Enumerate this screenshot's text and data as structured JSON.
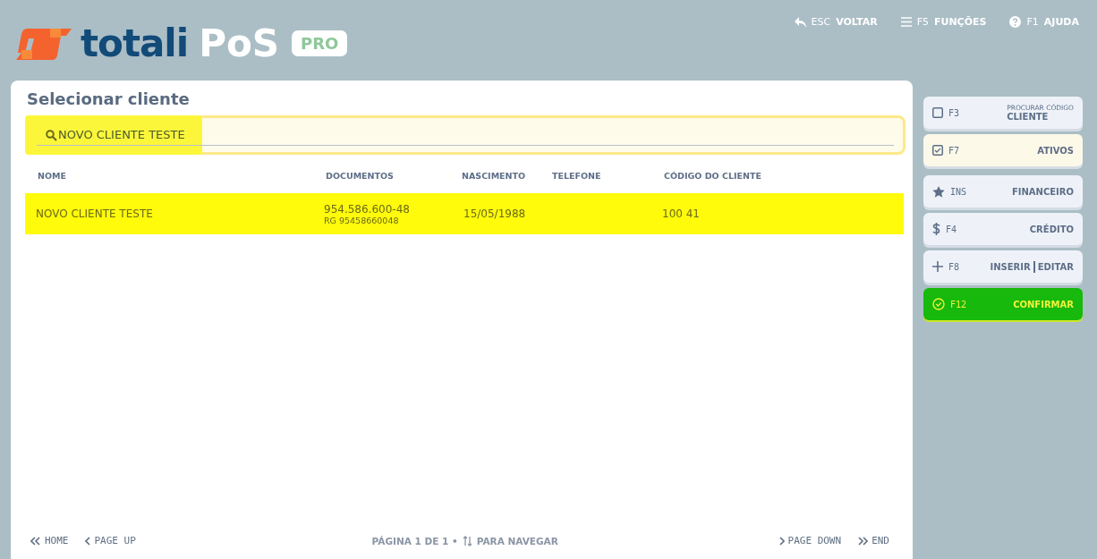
{
  "header": {
    "logo_text": "totali",
    "logo_product": "PoS",
    "logo_badge": "PRO",
    "actions": [
      {
        "kind": "back",
        "key": "ESC",
        "label": "VOLTAR"
      },
      {
        "kind": "menu",
        "key": "F5",
        "label": "FUNÇÕES"
      },
      {
        "kind": "help",
        "key": "F1",
        "label": "AJUDA"
      }
    ]
  },
  "panel": {
    "title": "Selecionar cliente",
    "search": {
      "value": "NOVO CLIENTE TESTE"
    },
    "table": {
      "columns": [
        "NOME",
        "DOCUMENTOS",
        "NASCIMENTO",
        "TELEFONE",
        "CÓDIGO DO CLIENTE"
      ],
      "rows": [
        {
          "selected": true,
          "name": "NOVO CLIENTE TESTE",
          "document": "954.586.600-48",
          "document_sub": "RG 95458660048",
          "birth": "15/05/1988",
          "code": "100 41"
        }
      ]
    },
    "pagination": {
      "home": "HOME",
      "page_up": "PAGE UP",
      "status": "PÁGINA 1 DE 1 •",
      "hint": "PARA NAVEGAR",
      "page_down": "PAGE DOWN",
      "end": "END"
    }
  },
  "sidebar": [
    {
      "kind": "checkbox",
      "key": "F3",
      "caption": "PROCURAR CÓDIGO",
      "label": "CLIENTE",
      "checked": false
    },
    {
      "kind": "checkbox",
      "key": "F7",
      "label": "ATIVOS",
      "checked": true
    },
    {
      "kind": "star",
      "key": "INS",
      "label": "FINANCEIRO"
    },
    {
      "kind": "dollar",
      "key": "F4",
      "label": "CRÉDITO"
    },
    {
      "kind": "plus",
      "key": "F8",
      "label": "INSERIR",
      "label_2": "EDITAR"
    },
    {
      "kind": "confirm",
      "key": "F12",
      "label": "CONFIRMAR"
    }
  ]
}
